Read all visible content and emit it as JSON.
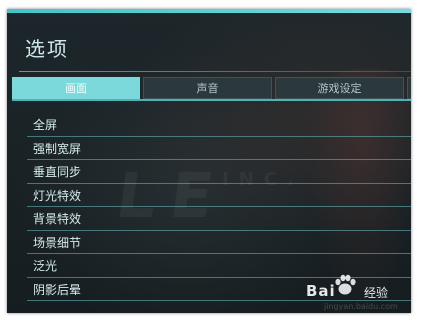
{
  "window": {
    "title": "选项"
  },
  "tabs": [
    {
      "label": "画面",
      "active": true
    },
    {
      "label": "声音",
      "active": false
    },
    {
      "label": "游戏设定",
      "active": false
    },
    {
      "label": "",
      "active": false
    }
  ],
  "settings": {
    "items": [
      {
        "label": "全屏"
      },
      {
        "label": "强制宽屏"
      },
      {
        "label": "垂直同步"
      },
      {
        "label": "灯光特效"
      },
      {
        "label": "背景特效"
      },
      {
        "label": "场景细节"
      },
      {
        "label": "泛光"
      },
      {
        "label": "阴影后晕"
      }
    ]
  },
  "watermark": {
    "brand": "Bai",
    "brand_suffix": "经验",
    "url": "jingyan.baidu.com",
    "icon": "baidu-paw-icon"
  },
  "colors": {
    "accent": "#7bd9db",
    "panel_bg": "#1b2327",
    "tab_bg": "#2b383c",
    "text": "#d6ecee"
  }
}
